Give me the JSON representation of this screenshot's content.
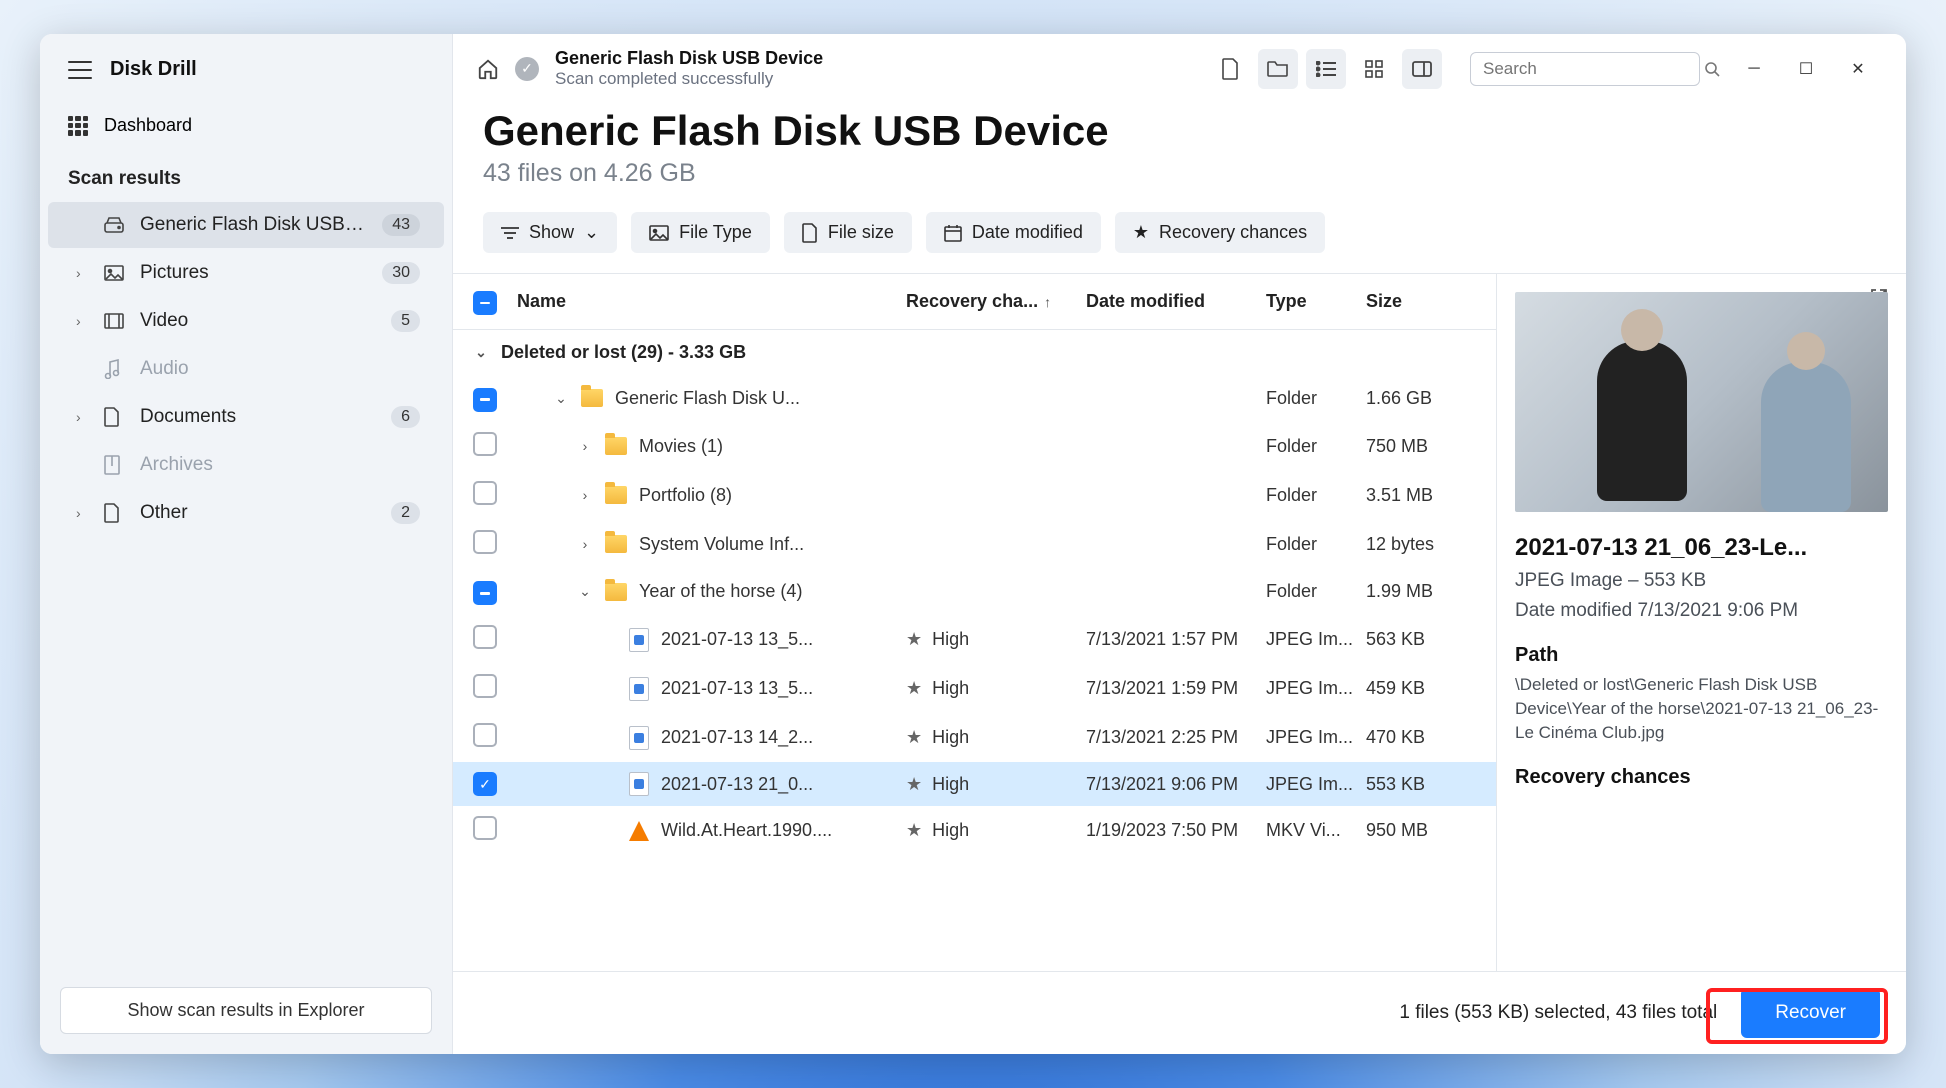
{
  "app": {
    "title": "Disk Drill"
  },
  "sidebar": {
    "dashboard": "Dashboard",
    "section": "Scan results",
    "items": [
      {
        "label": "Generic Flash Disk USB D...",
        "badge": "43",
        "icon": "drive",
        "selected": true,
        "expandable": false
      },
      {
        "label": "Pictures",
        "badge": "30",
        "icon": "image",
        "expandable": true
      },
      {
        "label": "Video",
        "badge": "5",
        "icon": "video",
        "expandable": true
      },
      {
        "label": "Audio",
        "badge": "",
        "icon": "audio",
        "disabled": true
      },
      {
        "label": "Documents",
        "badge": "6",
        "icon": "doc",
        "expandable": true
      },
      {
        "label": "Archives",
        "badge": "",
        "icon": "archive",
        "disabled": true
      },
      {
        "label": "Other",
        "badge": "2",
        "icon": "other",
        "expandable": true
      }
    ],
    "footer_button": "Show scan results in Explorer"
  },
  "breadcrumb": {
    "title": "Generic Flash Disk USB Device",
    "subtitle": "Scan completed successfully"
  },
  "search": {
    "placeholder": "Search"
  },
  "page": {
    "title": "Generic Flash Disk USB Device",
    "subtitle": "43 files on 4.26 GB"
  },
  "filters": {
    "show": "Show",
    "file_type": "File Type",
    "file_size": "File size",
    "date_modified": "Date modified",
    "recovery_chances": "Recovery chances"
  },
  "columns": {
    "name": "Name",
    "recovery": "Recovery cha...",
    "date": "Date modified",
    "type": "Type",
    "size": "Size"
  },
  "group": {
    "label": "Deleted or lost (29) - 3.33 GB"
  },
  "rows": [
    {
      "cb": "indet",
      "indent": 1,
      "chev": "down",
      "icon": "folder",
      "name": "Generic Flash Disk U...",
      "rec": "",
      "date": "",
      "type": "Folder",
      "size": "1.66 GB"
    },
    {
      "cb": "",
      "indent": 2,
      "chev": "right",
      "icon": "folder",
      "name": "Movies (1)",
      "rec": "",
      "date": "",
      "type": "Folder",
      "size": "750 MB"
    },
    {
      "cb": "",
      "indent": 2,
      "chev": "right",
      "icon": "folder",
      "name": "Portfolio (8)",
      "rec": "",
      "date": "",
      "type": "Folder",
      "size": "3.51 MB"
    },
    {
      "cb": "",
      "indent": 2,
      "chev": "right",
      "icon": "folder",
      "name": "System Volume Inf...",
      "rec": "",
      "date": "",
      "type": "Folder",
      "size": "12 bytes"
    },
    {
      "cb": "indet",
      "indent": 2,
      "chev": "down",
      "icon": "folder",
      "name": "Year of the horse (4)",
      "rec": "",
      "date": "",
      "type": "Folder",
      "size": "1.99 MB"
    },
    {
      "cb": "",
      "indent": 3,
      "chev": "",
      "icon": "img",
      "name": "2021-07-13 13_5...",
      "rec": "High",
      "date": "7/13/2021 1:57 PM",
      "type": "JPEG Im...",
      "size": "563 KB"
    },
    {
      "cb": "",
      "indent": 3,
      "chev": "",
      "icon": "img",
      "name": "2021-07-13 13_5...",
      "rec": "High",
      "date": "7/13/2021 1:59 PM",
      "type": "JPEG Im...",
      "size": "459 KB"
    },
    {
      "cb": "",
      "indent": 3,
      "chev": "",
      "icon": "img",
      "name": "2021-07-13 14_2...",
      "rec": "High",
      "date": "7/13/2021 2:25 PM",
      "type": "JPEG Im...",
      "size": "470 KB"
    },
    {
      "cb": "checked",
      "indent": 3,
      "chev": "",
      "icon": "img",
      "name": "2021-07-13 21_0...",
      "rec": "High",
      "date": "7/13/2021 9:06 PM",
      "type": "JPEG Im...",
      "size": "553 KB",
      "selected": true
    },
    {
      "cb": "",
      "indent": 3,
      "chev": "",
      "icon": "vlc",
      "name": "Wild.At.Heart.1990....",
      "rec": "High",
      "date": "1/19/2023 7:50 PM",
      "type": "MKV Vi...",
      "size": "950 MB"
    }
  ],
  "preview": {
    "title": "2021-07-13 21_06_23-Le...",
    "type_size": "JPEG Image – 553 KB",
    "date_label": "Date modified 7/13/2021 9:06 PM",
    "path_label": "Path",
    "path": "\\Deleted or lost\\Generic Flash Disk USB Device\\Year of the horse\\2021-07-13 21_06_23-Le Cinéma Club.jpg",
    "recovery_label": "Recovery chances"
  },
  "footer": {
    "status": "1 files (553 KB) selected, 43 files total",
    "recover": "Recover"
  }
}
